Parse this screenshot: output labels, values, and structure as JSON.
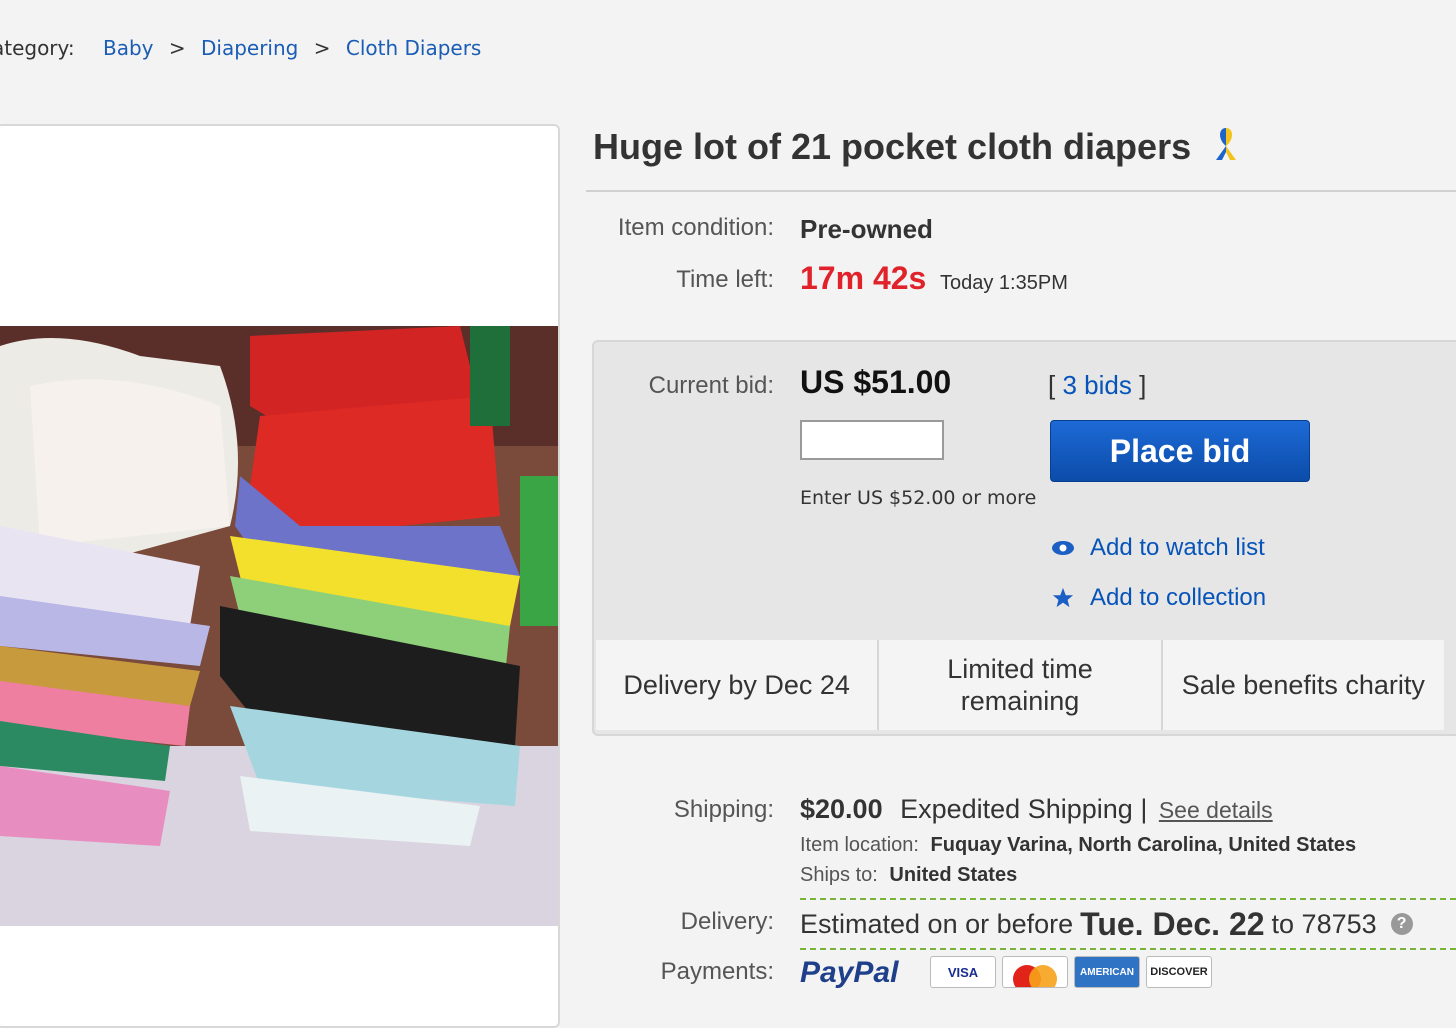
{
  "breadcrumb": {
    "label": "Category:",
    "items": [
      "Baby",
      "Diapering",
      "Cloth Diapers"
    ],
    "separator": ">"
  },
  "listing": {
    "title": "Huge lot of 21 pocket cloth diapers",
    "ribbon_icon": "charity-ribbon-icon",
    "condition_label": "Item condition:",
    "condition_value": "Pre-owned",
    "time_left_label": "Time left:",
    "time_left_value": "17m 42s",
    "end_time": "Today 1:35PM",
    "accent_red": "#e0232a"
  },
  "bid": {
    "current_label": "Current bid:",
    "current_value": "US $51.00",
    "bids_open": "[",
    "bids_link": "3 bids",
    "bids_close": "]",
    "input_value": "",
    "hint": "Enter US $52.00 or more",
    "place_bid_label": "Place bid",
    "watch_label": "Add to watch list",
    "collection_label": "Add to collection",
    "button_color": "#0b4ca9"
  },
  "benefits": [
    "Delivery by Dec 24",
    "Limited time remaining",
    "Sale benefits charity"
  ],
  "shipping": {
    "label": "Shipping:",
    "price": "$20.00",
    "method": "Expedited Shipping",
    "separator": "|",
    "details_link": "See details",
    "location_label": "Item location:",
    "location_value": "Fuquay Varina, North Carolina, United States",
    "ships_to_label": "Ships to:",
    "ships_to_value": "United States"
  },
  "delivery": {
    "label": "Delivery:",
    "prefix": "Estimated on or before",
    "date": "Tue. Dec. 22",
    "to_text": "to 78753",
    "help_icon": "?"
  },
  "payments": {
    "label": "Payments:",
    "methods": [
      "PayPal",
      "VISA",
      "MasterCard",
      "AMERICAN",
      "DISCOVER"
    ]
  }
}
